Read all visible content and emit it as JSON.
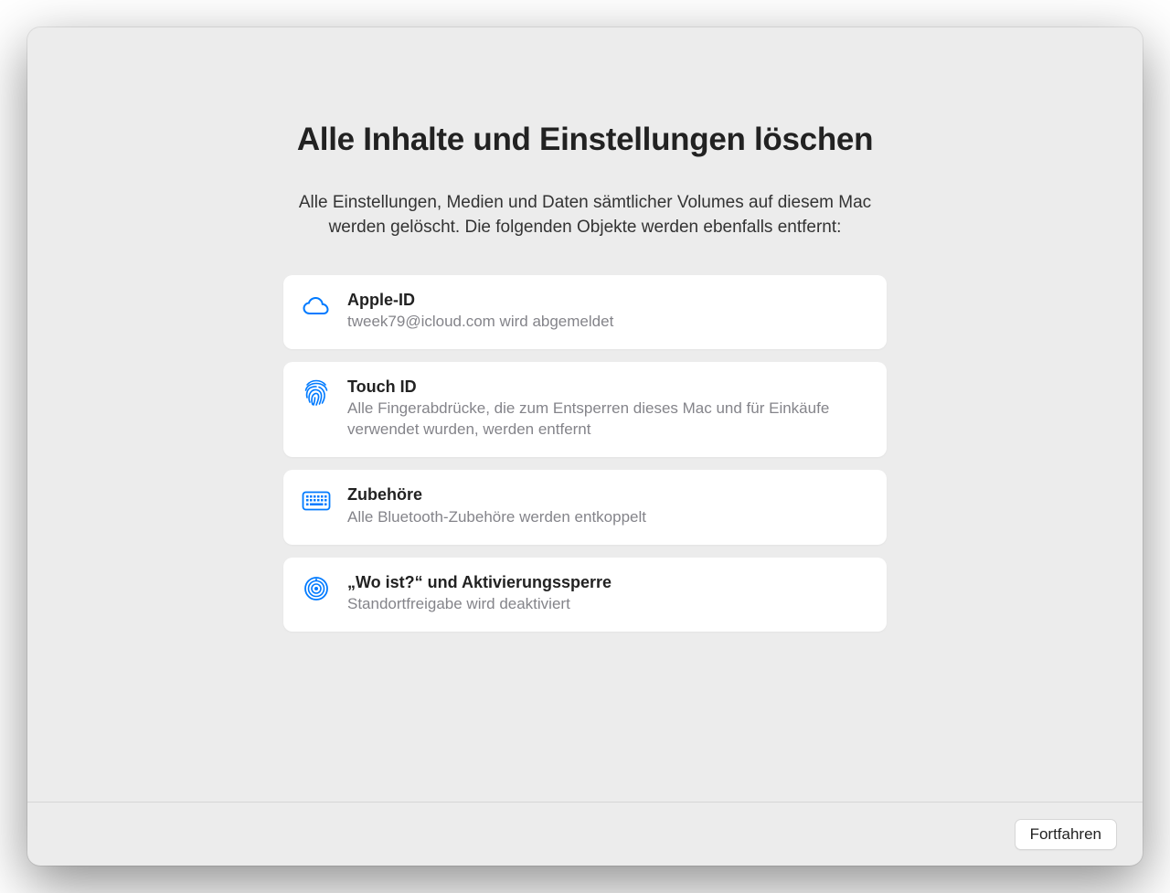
{
  "title": "Alle Inhalte und Einstellungen löschen",
  "subtitle": "Alle Einstellungen, Medien und Daten sämtlicher Volumes auf diesem Mac werden gelöscht. Die folgenden Objekte werden ebenfalls entfernt:",
  "items": [
    {
      "icon": "cloud-icon",
      "title": "Apple-ID",
      "desc": "tweek79@icloud.com wird abgemeldet"
    },
    {
      "icon": "fingerprint-icon",
      "title": "Touch ID",
      "desc": "Alle Fingerabdrücke, die zum Entsperren dieses Mac und für Einkäufe verwendet wurden, werden entfernt"
    },
    {
      "icon": "keyboard-icon",
      "title": "Zubehöre",
      "desc": "Alle Bluetooth-Zubehöre werden entkoppelt"
    },
    {
      "icon": "findmy-icon",
      "title": "„Wo ist?“ und Aktivierungssperre",
      "desc": "Standortfreigabe wird deaktiviert"
    }
  ],
  "footer": {
    "continue_label": "Fortfahren"
  }
}
